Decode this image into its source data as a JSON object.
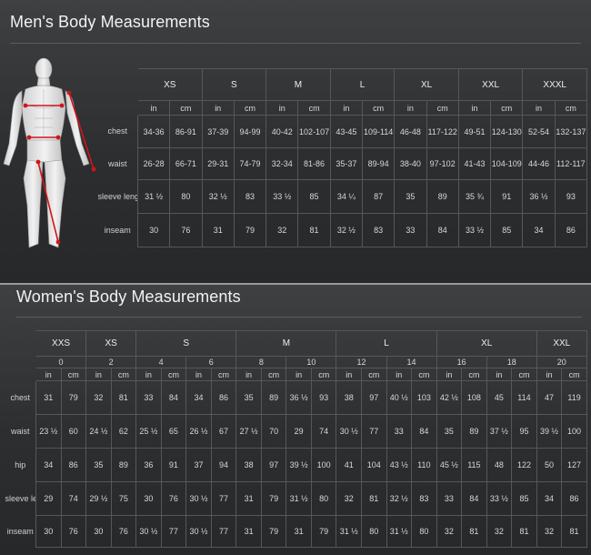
{
  "men": {
    "title": "Men's Body Measurements",
    "sizes": [
      "XS",
      "S",
      "M",
      "L",
      "XL",
      "XXL",
      "XXXL"
    ],
    "units": [
      "in",
      "cm"
    ],
    "rows": [
      {
        "label": "chest",
        "values": [
          "34-36",
          "86-91",
          "37-39",
          "94-99",
          "40-42",
          "102-107",
          "43-45",
          "109-114",
          "46-48",
          "117-122",
          "49-51",
          "124-130",
          "52-54",
          "132-137"
        ]
      },
      {
        "label": "waist",
        "values": [
          "26-28",
          "66-71",
          "29-31",
          "74-79",
          "32-34",
          "81-86",
          "35-37",
          "89-94",
          "38-40",
          "97-102",
          "41-43",
          "104-109",
          "44-46",
          "112-117"
        ]
      },
      {
        "label": "sleeve length",
        "values": [
          "31 ½",
          "80",
          "32 ½",
          "83",
          "33 ½",
          "85",
          "34 ¼",
          "87",
          "35",
          "89",
          "35 ¾",
          "91",
          "36 ½",
          "93"
        ]
      },
      {
        "label": "inseam",
        "values": [
          "30",
          "76",
          "31",
          "79",
          "32",
          "81",
          "32 ½",
          "83",
          "33",
          "84",
          "33 ½",
          "85",
          "34",
          "86"
        ]
      }
    ]
  },
  "women": {
    "title": "Women's Body Measurements",
    "size_groups": [
      {
        "label": "XXS",
        "numbers": [
          "0"
        ]
      },
      {
        "label": "XS",
        "numbers": [
          "2"
        ]
      },
      {
        "label": "S",
        "numbers": [
          "4",
          "6"
        ]
      },
      {
        "label": "M",
        "numbers": [
          "8",
          "10"
        ]
      },
      {
        "label": "L",
        "numbers": [
          "12",
          "14"
        ]
      },
      {
        "label": "XL",
        "numbers": [
          "16",
          "18"
        ]
      },
      {
        "label": "XXL",
        "numbers": [
          "20"
        ]
      }
    ],
    "units": [
      "in",
      "cm"
    ],
    "rows": [
      {
        "label": "chest",
        "values": [
          "31",
          "79",
          "32",
          "81",
          "33",
          "84",
          "34",
          "86",
          "35",
          "89",
          "36 ½",
          "93",
          "38",
          "97",
          "40 ½",
          "103",
          "42 ½",
          "108",
          "45",
          "114",
          "47",
          "119"
        ]
      },
      {
        "label": "waist",
        "values": [
          "23 ½",
          "60",
          "24 ½",
          "62",
          "25 ½",
          "65",
          "26 ½",
          "67",
          "27 ½",
          "70",
          "29",
          "74",
          "30 ½",
          "77",
          "33",
          "84",
          "35",
          "89",
          "37 ½",
          "95",
          "39 ½",
          "100"
        ]
      },
      {
        "label": "hip",
        "values": [
          "34",
          "86",
          "35",
          "89",
          "36",
          "91",
          "37",
          "94",
          "38",
          "97",
          "39 ½",
          "100",
          "41",
          "104",
          "43 ½",
          "110",
          "45 ½",
          "115",
          "48",
          "122",
          "50",
          "127"
        ]
      },
      {
        "label": "sleeve length",
        "values": [
          "29",
          "74",
          "29 ½",
          "75",
          "30",
          "76",
          "30 ½",
          "77",
          "31",
          "79",
          "31 ½",
          "80",
          "32",
          "81",
          "32 ½",
          "83",
          "33",
          "84",
          "33 ½",
          "85",
          "34",
          "86"
        ]
      },
      {
        "label": "inseam",
        "values": [
          "30",
          "76",
          "30",
          "76",
          "30 ½",
          "77",
          "30 ½",
          "77",
          "31",
          "79",
          "31",
          "79",
          "31 ½",
          "80",
          "31 ½",
          "80",
          "32",
          "81",
          "32",
          "81",
          "32",
          "81"
        ]
      }
    ]
  },
  "colors": {
    "background": "#2a2c2e",
    "grid": "#55585a",
    "measure_line": "#d0151a",
    "text": "#e6e6e6"
  },
  "icons": {
    "figure": "male-anatomy-figure-icon"
  }
}
